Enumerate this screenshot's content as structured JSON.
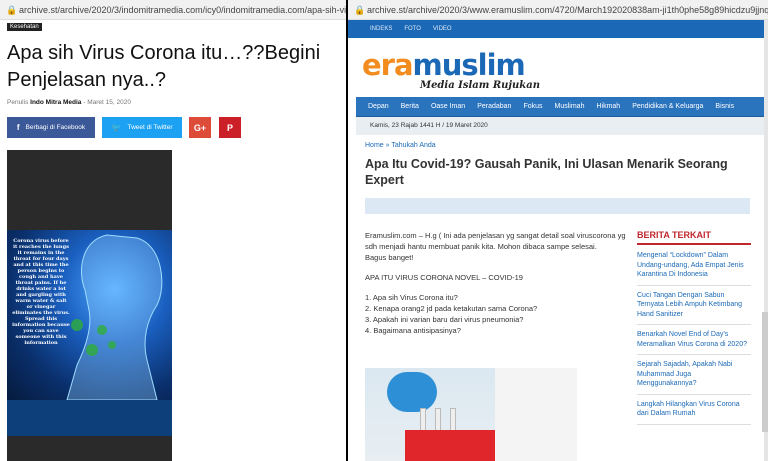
{
  "left": {
    "url": "archive.st/archive/2020/3/indomitramedia.com/icy0/indomitramedia.com/apa-sih-virus-corona",
    "category": "Kesehatan",
    "title_line1": "Apa sih Virus Corona itu…??Begini",
    "title_line2": "Penjelasan nya..?",
    "meta_prefix": "Penulis",
    "author": "Indo Mitra Media",
    "date": "Maret 15, 2020",
    "share": {
      "facebook": "Berbagi di Facebook",
      "twitter": "Tweet di Twitter",
      "gplus": "G+",
      "pinterest": "P"
    },
    "image_text": "Corona virus before it reaches the lungs it remains in the throat for four days and at this time the person begins to cough and have throat pains. If he drinks water a lot and gargling with warm water & salt or vinegar eliminates the virus. Spread this information because you can save someone with this information"
  },
  "right": {
    "url": "archive.st/archive/2020/3/www.eramuslim.com/4720/March192020838am-ji1th0phe58g89hicdzu9jjnqp940wg.jpg",
    "topnav": [
      "INDEKS",
      "FOTO",
      "VIDEO"
    ],
    "logo_era": "era",
    "logo_muslim": "muslim",
    "logo_tagline": "Media Islam Rujukan",
    "mainnav": [
      "Depan",
      "Berita",
      "Oase Iman",
      "Peradaban",
      "Fokus",
      "Muslimah",
      "Hikmah",
      "Pendidikan & Keluarga",
      "Bisnis"
    ],
    "date": "Kamis, 23 Rajab 1441 H / 19 Maret 2020",
    "breadcrumb": "Home » Tahukah Anda",
    "title": "Apa Itu Covid-19? Gausah Panik, Ini Ulasan Menarik Seorang Expert",
    "body_p1": "Eramuslim.com – H.g ( Ini ada penjelasan yg sangat detail soal viruscorona yg sdh menjadi hantu membuat panik kita. Mohon dibaca sampe selesai.",
    "body_p2": "Bagus banget!",
    "body_heading": "APA ITU VIRUS CORONA NOVEL – COVID-19",
    "questions": [
      "1. Apa sih Virus Corona itu?",
      "2. Kenapa orang2 jd pada ketakutan sama Corona?",
      "3. Apakah ini varian baru dari virus pneumonia?",
      "4. Bagaimana antisipasinya?"
    ],
    "sidebar_title": "BERITA TERKAIT",
    "sidebar_items": [
      "Mengenal “Lockdown” Dalam Undang-undang, Ada Empat Jenis Karantina Di Indonesia",
      "Cuci Tangan Dengan Sabun Ternyata Lebih Ampuh Ketimbang Hand Sanitizer",
      "Benarkah Novel End of Day’s Meramalkan Virus Corona di 2020?",
      "Sejarah Sajadah, Apakah Nabi Muhammad Juga Menggunakannya?",
      "Langkah Hilangkan Virus Corona dari Dalam Rumah"
    ]
  },
  "colors": {
    "brand_blue": "#1b69b6",
    "brand_orange": "#f28c1e",
    "related_red": "#c0272d",
    "facebook": "#3b5998",
    "twitter": "#1da1f2",
    "gplus": "#dd4b39",
    "pinterest": "#cb2027"
  }
}
